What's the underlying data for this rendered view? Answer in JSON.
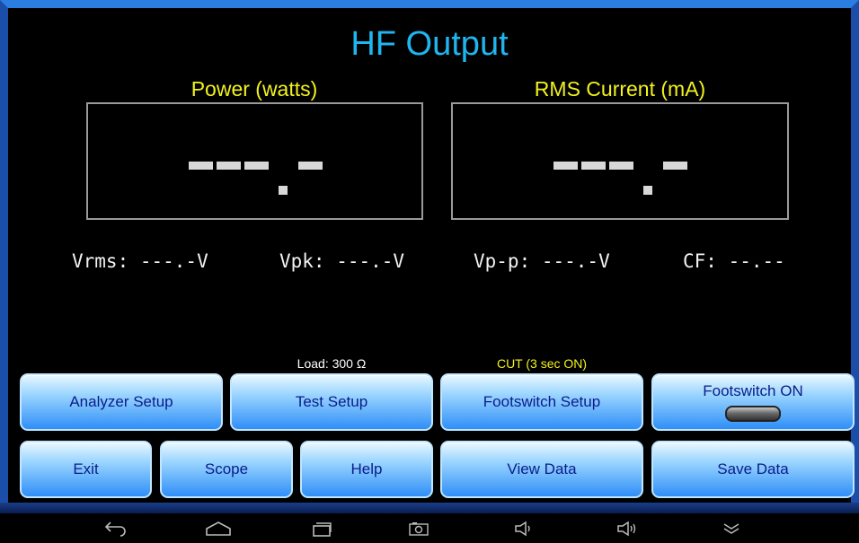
{
  "title": "HF Output",
  "power_panel": {
    "label": "Power (watts)",
    "display": "---.-"
  },
  "current_panel": {
    "label": "RMS Current (mA)",
    "display": "---.-"
  },
  "readouts": {
    "vrms": "Vrms: ---.-V",
    "vpk": "Vpk: ---.-V",
    "vpp": "Vp-p: ---.-V",
    "cf": "CF: --.--"
  },
  "status": {
    "load": "Load: 300 Ω",
    "mode": "CUT (3 sec ON)",
    "load_color": "#ffffff",
    "mode_color": "#f2f21d"
  },
  "buttons": {
    "analyzer_setup": "Analyzer Setup",
    "test_setup": "Test Setup",
    "footswitch_setup": "Footswitch Setup",
    "footswitch_on": "Footswitch ON",
    "exit": "Exit",
    "scope": "Scope",
    "help": "Help",
    "view_data": "View Data",
    "save_data": "Save Data"
  },
  "colors": {
    "title": "#1fb6f0",
    "panel_label": "#f2f21d",
    "button_text": "#0a1c8a",
    "frame": "#2b7de0"
  },
  "nav_icons": [
    "back-icon",
    "home-icon",
    "recents-icon",
    "screenshot-icon",
    "volume-down-icon",
    "volume-up-icon",
    "menu-collapse-icon"
  ]
}
